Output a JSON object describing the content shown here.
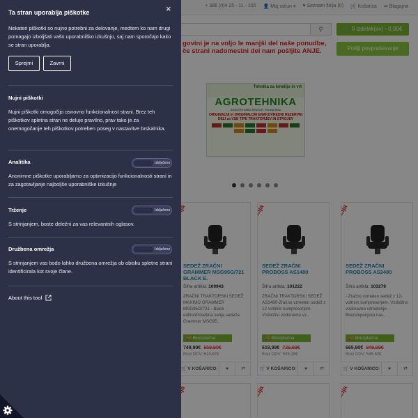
{
  "page": {
    "topbar": {
      "phone": "+ 386 (0)4 25 - 11 - 155",
      "account": "Moj račun",
      "wishlist": "Seznam želja (0)",
      "cart": "Košarica",
      "checkout": "Blagajna"
    },
    "cart_button": "0 izdelek(ov) - 0,00€",
    "inquiry_button": "Pošlji povpraševanje",
    "promo_text": "govini je na voljo le manjši del naše ponudbe, če strani nadomestni del nam pošljite ",
    "promo_link": "ANJE.",
    "banner": {
      "top": "Tehnika za kmetijo in vrt",
      "logo": "AGROTEHNIKA",
      "sub": "AGROTEHNIKA ŠENČUR, Srednja Bela",
      "red": "ORIGINALNI in ORIGINALOM ENAKOVREDNI REZERVNI DELI za VSE TIPE TRAKTORJEV IN STROJEV"
    },
    "products": [
      {
        "ribbon": "Akcija",
        "name": "SEDEŽ ZRAČNI GRAMMER MSG95G/721 BLACK E.",
        "sku_label": "Šifra artikla:",
        "sku": "109943",
        "desc": "ZRAČNI TRAKTORSKI SEDEŽ MAXIMO GRAMMER MSG95G/721 - Black editionPosebna serija sedeža Grammer MSG95..",
        "shipping": "Brezplačna dostava",
        "price": "749,90€",
        "old_price": "859,90€",
        "vat": "Brez DDV: 614,67€",
        "buy": "V KOŠARICO"
      },
      {
        "ribbon": "Akcija",
        "name": "SEDEŽ ZRAČNI PROBOSS AS1480",
        "sku_label": "Šifra artikla:",
        "sku": "101222",
        "desc": "ZRAČNI TRAKTORSKI SEDEŽ AS1480-Zračno vzmeten sedež z 12-voltnim kompresorjem-Vzdolžno vodoravno vz..",
        "shipping": "Brezplačna dostava",
        "price": "619,99€",
        "old_price": "729,99€",
        "vat": "Brez DDV: 508,19€",
        "buy": "V KOŠARICO"
      },
      {
        "ribbon": "Akcija",
        "name": "SEDEŽ ZRAČNI PROBOSS AS2480",
        "sku_label": "Šifra artikla:",
        "sku": "103279",
        "desc": "- Zračno vzmeten sedež z 12-voltnim kompresorjem- Vzdolžno vodoravno vzmetenje- Brezstopenjsko nas..",
        "shipping": "Brezplačna dostava",
        "price": "665,90€",
        "old_price": "849,99€",
        "vat": "Brez DDV: 545,82€",
        "buy": "V KOŠARICO"
      }
    ],
    "second_row_ribbons": [
      "Akcija",
      "Akcija",
      "Akcija"
    ]
  },
  "cookie_panel": {
    "title": "Ta stran uporablja piškotke",
    "close_icon": "×",
    "intro": "Nekateri piškotki so nujno potrebni za delovanje, medtem ko nam drugi pomagajo izboljšati vašo uporabniško izkušnjo, saj nam sporočajo kako se stran uporablja.",
    "accept_button": "Sprejmi",
    "reject_button": "Zavrni",
    "sections": [
      {
        "title": "Nujni piškotki",
        "text": "Nujni piškotki omogočijo osnovno funkcionalnost strani. Brez teh piškotkov spletna stran ne deluje pravilno, prav tako je za onemogočanje teh piškotkov potreben poseg v nastavitve brskalnika."
      },
      {
        "title": "Analitika",
        "text": "Anonimne piškotke uporabljamo za optimizacijo funkcionalnosti strani in za zagotavljanje najboljše uporabniške izkušnje",
        "toggle": "Izključeno"
      },
      {
        "title": "Trženje",
        "text": "S strinjanjem, boste deležni za vas relevantnih oglasov.",
        "toggle": "Izključeno"
      },
      {
        "title": "Družbena omrežja",
        "text": "S strinjanjem vas bodo lahko družbena omrežja ob obisku spletne strani identificirala kot svoje člane.",
        "toggle": "Izključeno"
      }
    ],
    "about_link": "About this tool"
  },
  "colors": {
    "panel_bg": "#2d3147",
    "accent_green": "#7ab32e",
    "product_title": "#1a8ab5",
    "sale_red": "#dd2222"
  }
}
